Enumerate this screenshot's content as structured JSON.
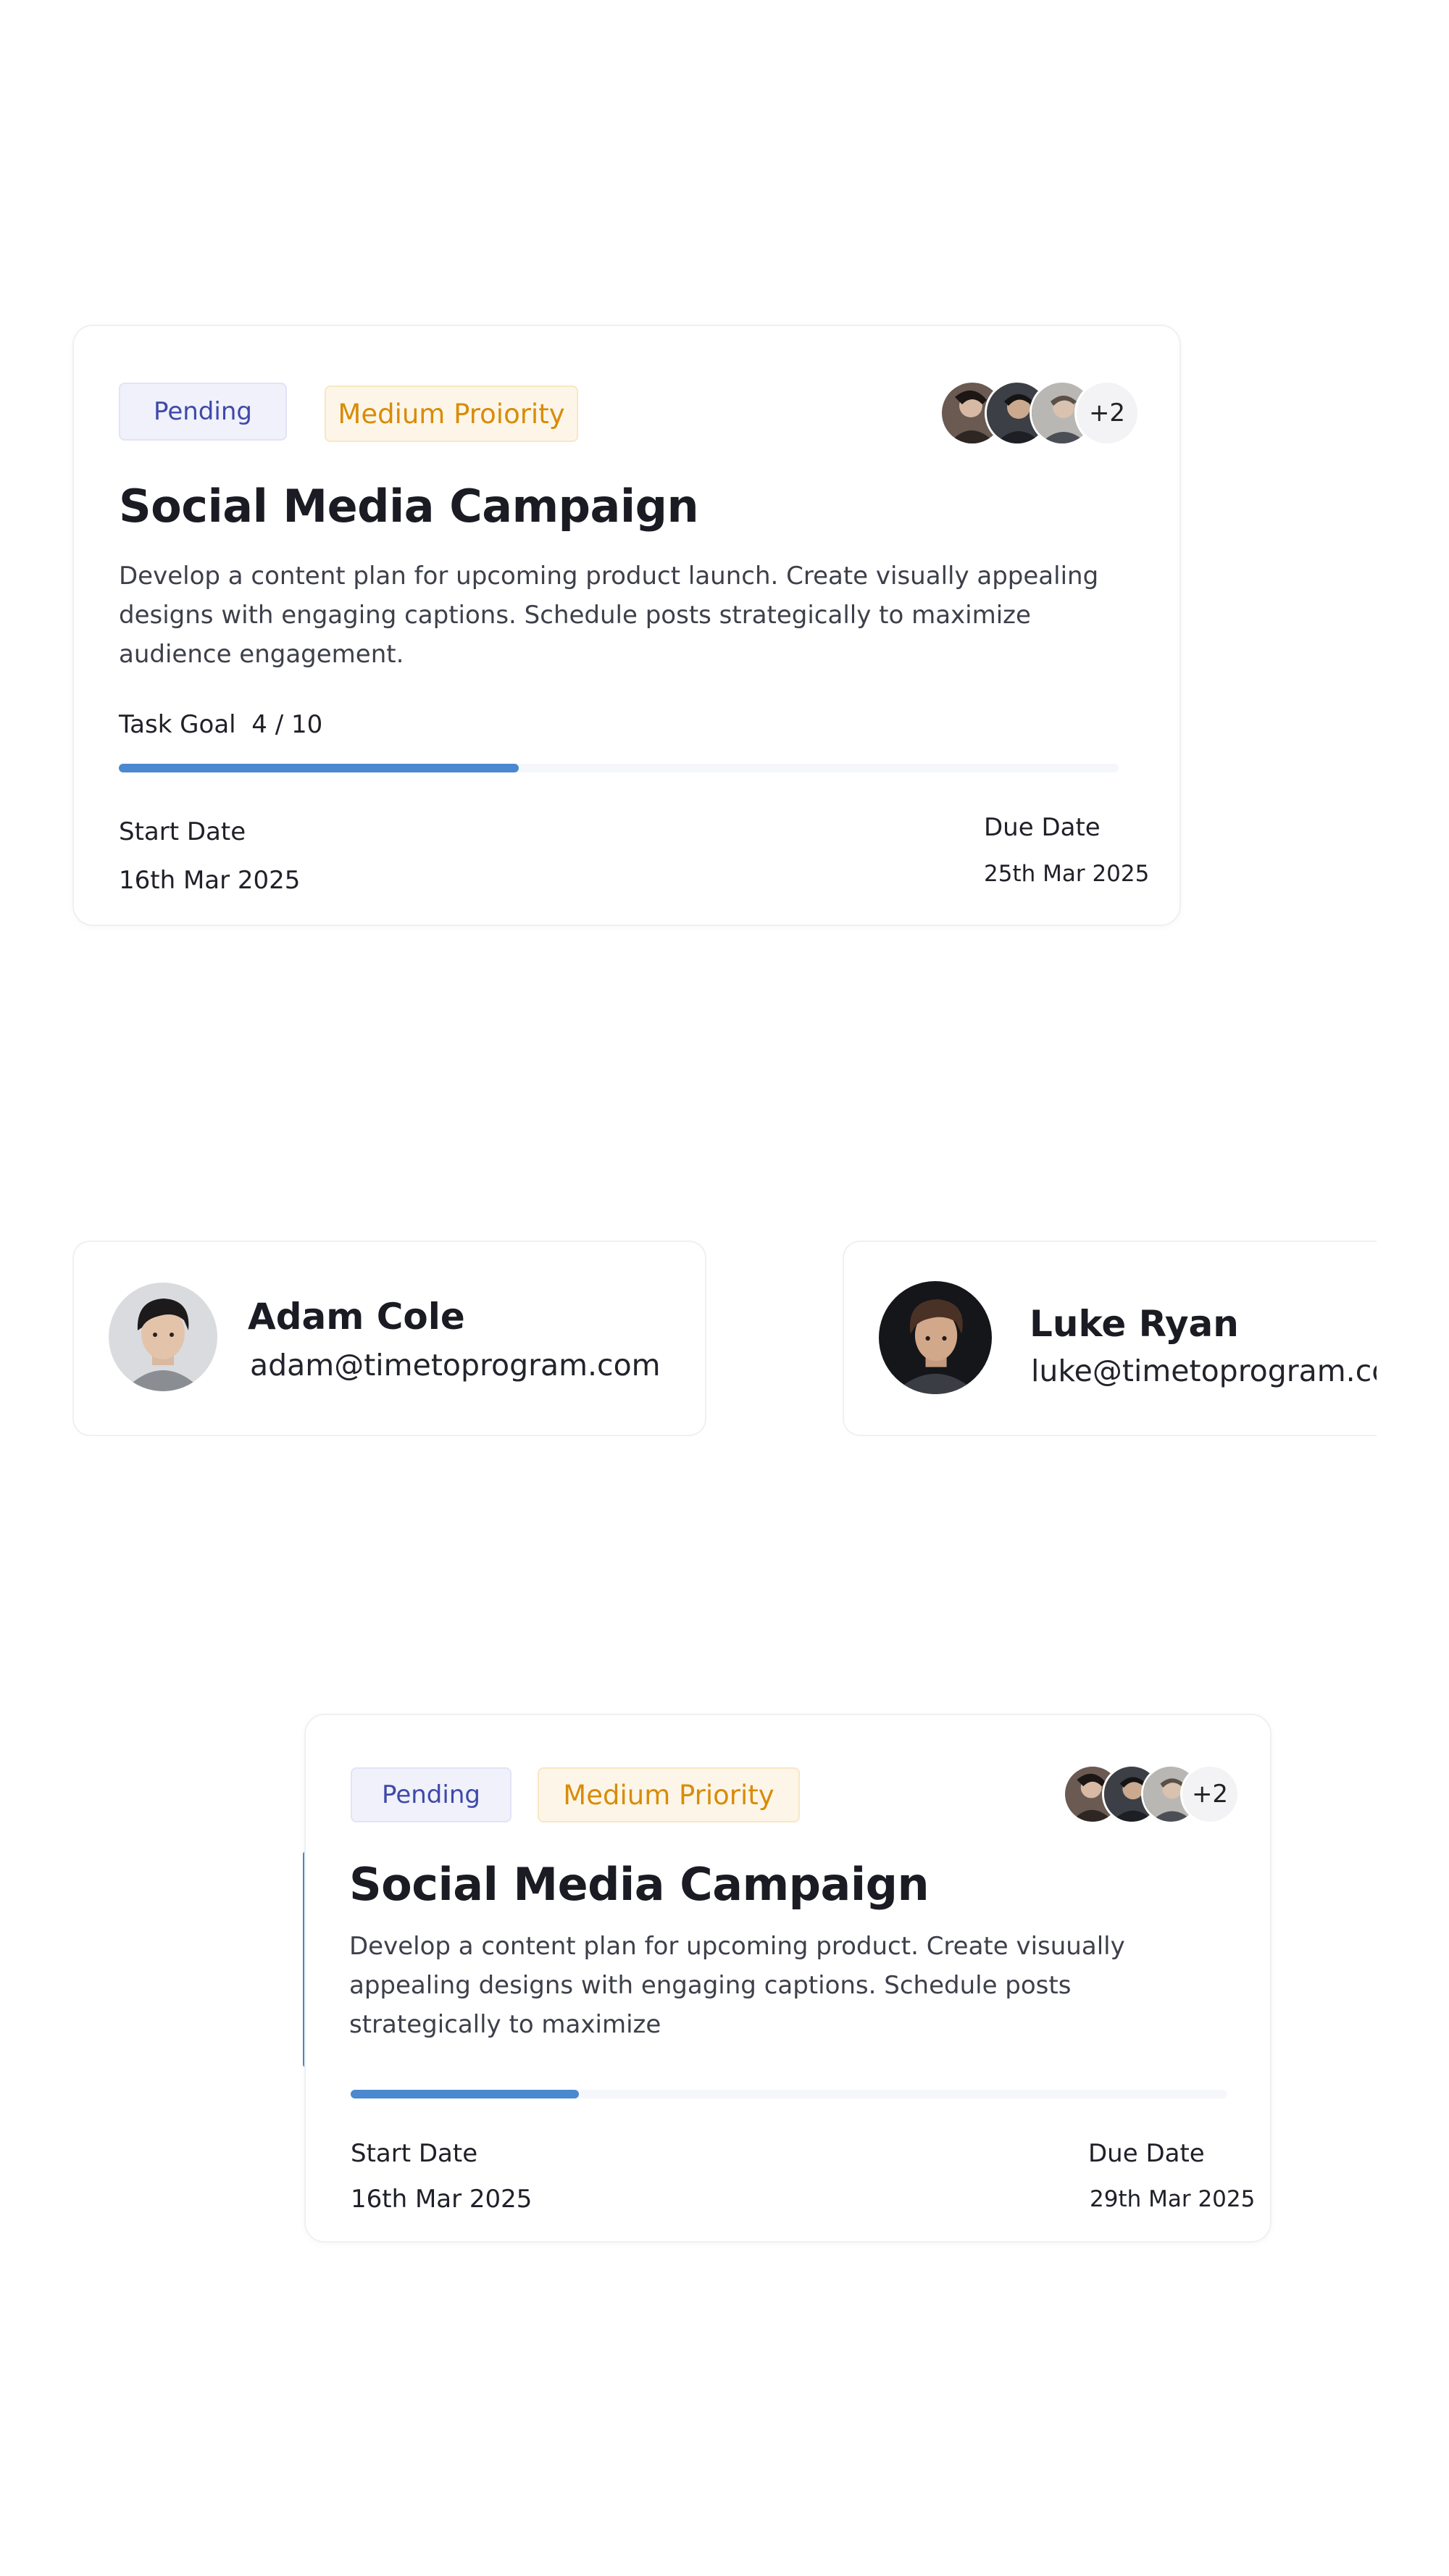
{
  "task_cards": [
    {
      "status": "Pending",
      "priority": "Medium Proiority",
      "extra_assignees": "+2",
      "title": "Social Media Campaign",
      "description": "Develop a content plan for upcoming product launch. Create visually appealing designs with engaging captions. Schedule posts strategically to maximize audience engagement.",
      "goal_label": "Task Goal",
      "goal_value": "4 / 10",
      "progress": 0.4,
      "start_label": "Start Date",
      "start_date": "16th Mar 2025",
      "due_label": "Due Date",
      "due_date": "25th Mar 2025"
    },
    {
      "status": "Pending",
      "priority": "Medium Priority",
      "extra_assignees": "+2",
      "title": "Social Media Campaign",
      "description": "Develop a content plan for upcoming  product. Create visuually appealing designs with engaging captions. Schedule posts strategically to maximize",
      "progress": 0.26,
      "start_label": "Start Date",
      "start_date": "16th Mar 2025",
      "due_label": "Due Date",
      "due_date": "29th Mar 2025"
    }
  ],
  "users": [
    {
      "name": "Adam Cole",
      "email": "adam@timetoprogram.com"
    },
    {
      "name": "Luke Ryan",
      "email": "luke@timetoprogram.com"
    }
  ],
  "colors": {
    "accent": "#4a88cf",
    "pending_text": "#3f49a8",
    "pending_bg": "#f0f1fb",
    "priority_text": "#d98b08",
    "priority_bg": "#fdf6e8"
  }
}
